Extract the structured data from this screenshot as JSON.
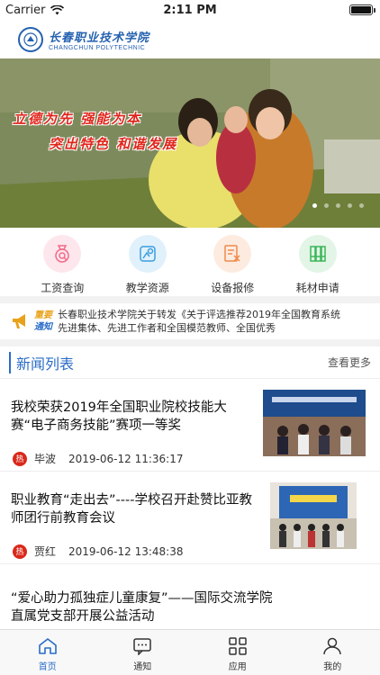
{
  "status": {
    "carrier": "Carrier",
    "time": "2:11 PM"
  },
  "header": {
    "logo_cn": "长春职业技术学院",
    "logo_en": "CHANGCHUN POLYTECHNIC"
  },
  "banner": {
    "slogan_line1": "立德为先  强能为本",
    "slogan_line2": "突出特色  和谐发展",
    "slide_count": 5,
    "active_slide": 1
  },
  "quick_actions": [
    {
      "label": "工资查询",
      "icon": "salary-search-icon",
      "color": "#f26b8a"
    },
    {
      "label": "教学资源",
      "icon": "teaching-resource-icon",
      "color": "#3a9ee0"
    },
    {
      "label": "设备报修",
      "icon": "repair-icon",
      "color": "#f08a4b"
    },
    {
      "label": "耗材申请",
      "icon": "supplies-icon",
      "color": "#3cb65a"
    }
  ],
  "notice": {
    "tag_top": "重要",
    "tag_bottom": "通知",
    "text": "长春职业技术学院关于转发《关于评选推荐2019年全国教育系统先进集体、先进工作者和全国模范教师、全国优秀"
  },
  "news": {
    "title": "新闻列表",
    "more": "查看更多",
    "items": [
      {
        "title": "我校荣获2019年全国职业院校技能大赛“电子商务技能”赛项一等奖",
        "author": "毕波",
        "time": "2019-06-12 11:36:17",
        "hot": "热"
      },
      {
        "title": "职业教育“走出去”----学校召开赴赞比亚教师团行前教育会议",
        "author": "贾红",
        "time": "2019-06-12 13:48:38",
        "hot": "热"
      },
      {
        "title": "“爱心助力孤独症儿童康复”——国际交流学院直属党支部开展公益活动"
      }
    ]
  },
  "tabbar": [
    {
      "label": "首页",
      "icon": "home-icon",
      "active": true
    },
    {
      "label": "通知",
      "icon": "message-icon",
      "active": false
    },
    {
      "label": "应用",
      "icon": "apps-icon",
      "active": false
    },
    {
      "label": "我的",
      "icon": "profile-icon",
      "active": false
    }
  ],
  "colors": {
    "accent": "#2a6cc7",
    "hot": "#d9281b"
  }
}
